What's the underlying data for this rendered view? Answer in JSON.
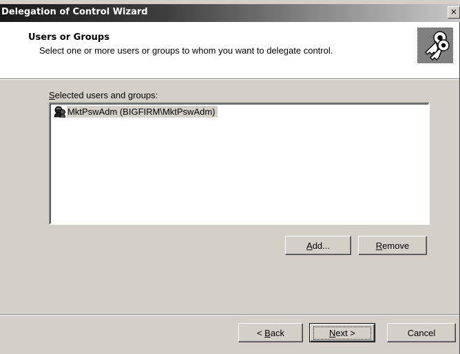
{
  "window": {
    "title": "Delegation of Control Wizard",
    "close_glyph": "×"
  },
  "header": {
    "title": "Users or Groups",
    "subtitle": "Select one or more users or groups to whom you want to delegate control.",
    "icon": "keys-icon"
  },
  "list": {
    "label": "Selected users and groups:",
    "label_accel": "S",
    "label_rest": "elected users and groups:",
    "items": [
      {
        "icon": "user-icon",
        "label": "MktPswAdm (BIGFIRM\\MktPswAdm)",
        "selected": true
      }
    ]
  },
  "buttons": {
    "add": {
      "label": "Add...",
      "accel": "A",
      "rest": "dd..."
    },
    "remove": {
      "label": "Remove",
      "accel": "R",
      "rest": "emove"
    },
    "back": {
      "label": "< Back",
      "pre": "< ",
      "accel": "B",
      "rest": "ack"
    },
    "next": {
      "label": "Next >",
      "accel": "N",
      "rest": "ext >"
    },
    "cancel": {
      "label": "Cancel"
    }
  },
  "colors": {
    "face": "#d4d0c8",
    "header_bg": "#ffffff",
    "titlebar_start": "#1a1a1a",
    "titlebar_end": "#c8c8c8",
    "selection_bg": "#d4d0c8"
  }
}
